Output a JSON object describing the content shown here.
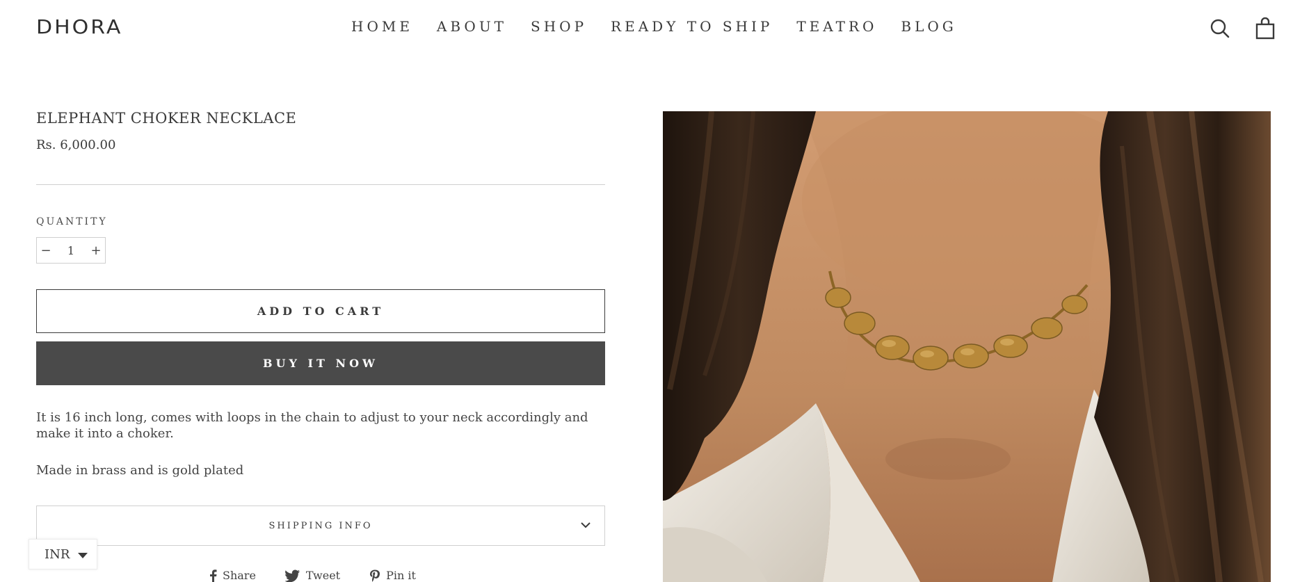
{
  "brand": {
    "logo_text": "DHORA"
  },
  "nav": {
    "items": [
      {
        "label": "HOME"
      },
      {
        "label": "ABOUT"
      },
      {
        "label": "SHOP"
      },
      {
        "label": "READY TO SHIP"
      },
      {
        "label": "TEATRO"
      },
      {
        "label": "BLOG"
      }
    ],
    "icons": [
      "search-icon",
      "cart-bag-icon"
    ]
  },
  "product": {
    "title": "ELEPHANT CHOKER NECKLACE",
    "price": "Rs. 6,000.00",
    "quantity_label": "QUANTITY",
    "quantity_value": "1",
    "minus": "−",
    "plus": "+",
    "add_to_cart": "ADD TO CART",
    "buy_now": "BUY IT NOW",
    "description": [
      "It is 16 inch long, comes with loops in the chain to adjust to your neck accordingly and make it into a choker.",
      "Made in brass and is gold plated"
    ],
    "accordion_label": "SHIPPING INFO",
    "image_alt": "Gold elephant choker necklace worn on neck"
  },
  "share": {
    "facebook": "Share",
    "twitter": "Tweet",
    "pinterest": "Pin it"
  },
  "currency": {
    "selected": "INR"
  },
  "colors": {
    "text": "#3a3a3a",
    "button_dark": "#4a4a4a",
    "border": "#cfcfcf",
    "skin": "#c38d63",
    "hair": "#2a1c12",
    "gold": "#b8893a",
    "shirt": "#ece7df"
  }
}
